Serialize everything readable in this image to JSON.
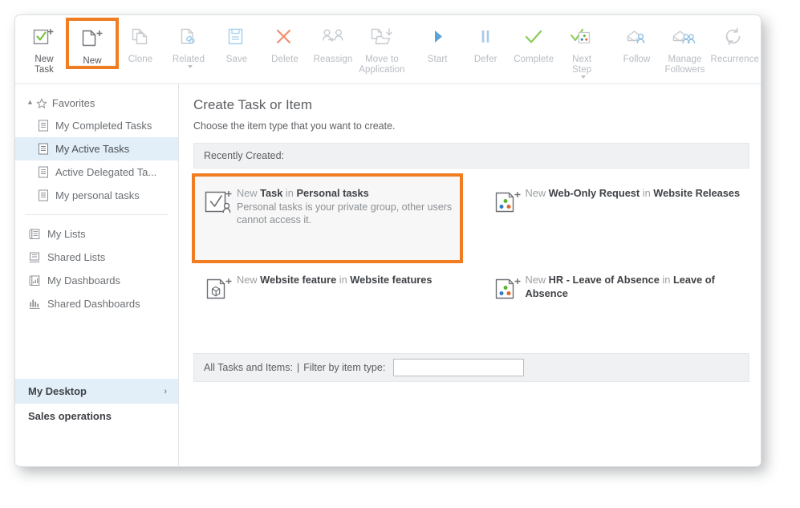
{
  "toolbar": {
    "items": [
      {
        "label": "New\nTask",
        "icon": "new-task-icon",
        "state": "enabled",
        "highlight": false,
        "caret": false
      },
      {
        "label": "New",
        "icon": "new-document-icon",
        "state": "enabled",
        "highlight": true,
        "caret": false
      },
      {
        "label": "Clone",
        "icon": "clone-icon",
        "state": "disabled",
        "highlight": false,
        "caret": false
      },
      {
        "label": "Related",
        "icon": "related-link-icon",
        "state": "disabled",
        "highlight": false,
        "caret": true
      },
      {
        "label": "Save",
        "icon": "save-floppy-icon",
        "state": "disabled",
        "highlight": false,
        "caret": false
      },
      {
        "label": "Delete",
        "icon": "delete-x-icon",
        "state": "disabled",
        "highlight": false,
        "caret": false
      },
      {
        "label": "Reassign",
        "icon": "reassign-users-icon",
        "state": "disabled",
        "highlight": false,
        "caret": false
      },
      {
        "label": "Move to\nApplication",
        "icon": "move-to-application-icon",
        "state": "disabled",
        "highlight": false,
        "caret": false
      },
      {
        "label": "Start",
        "icon": "start-play-icon",
        "state": "disabled",
        "highlight": false,
        "caret": false
      },
      {
        "label": "Defer",
        "icon": "defer-pause-icon",
        "state": "disabled",
        "highlight": false,
        "caret": false
      },
      {
        "label": "Complete",
        "icon": "complete-check-icon",
        "state": "disabled",
        "highlight": false,
        "caret": false
      },
      {
        "label": "Next\nStep",
        "icon": "next-step-icon",
        "state": "disabled",
        "highlight": false,
        "caret": true
      },
      {
        "label": "Follow",
        "icon": "follow-envelope-icon",
        "state": "disabled",
        "highlight": false,
        "caret": false
      },
      {
        "label": "Manage\nFollowers",
        "icon": "manage-followers-icon",
        "state": "disabled",
        "highlight": false,
        "caret": false
      },
      {
        "label": "Recurrence",
        "icon": "recurrence-icon",
        "state": "disabled",
        "highlight": false,
        "caret": false
      }
    ]
  },
  "sidebar": {
    "favorites_label": "Favorites",
    "favorites": [
      {
        "label": "My Completed Tasks",
        "icon": "list-icon",
        "selected": false
      },
      {
        "label": "My Active Tasks",
        "icon": "list-icon",
        "selected": true
      },
      {
        "label": "Active Delegated Ta...",
        "icon": "list-icon",
        "selected": false
      },
      {
        "label": "My personal tasks",
        "icon": "list-icon",
        "selected": false
      }
    ],
    "groups": [
      {
        "label": "My Lists",
        "icon": "my-lists-icon"
      },
      {
        "label": "Shared Lists",
        "icon": "shared-lists-icon"
      },
      {
        "label": "My Dashboards",
        "icon": "my-dashboards-icon"
      },
      {
        "label": "Shared Dashboards",
        "icon": "shared-dashboards-icon"
      }
    ],
    "desktops": [
      {
        "label": "My Desktop",
        "selected": true,
        "chevron": "›"
      },
      {
        "label": "Sales operations",
        "selected": false,
        "chevron": ""
      }
    ]
  },
  "main": {
    "title": "Create Task or Item",
    "subtitle": "Choose the item type that you want to create.",
    "recent_label": "Recently Created:",
    "cards": [
      {
        "prefix": "New ",
        "type": "Task",
        "joiner": " in ",
        "container": "Personal tasks",
        "desc": "Personal tasks is your private group, other users cannot access it.",
        "icon": "new-task-person-icon",
        "highlight": true
      },
      {
        "prefix": "New ",
        "type": "Web-Only Request",
        "joiner": " in ",
        "container": "Website Releases",
        "desc": "",
        "icon": "item-dots-icon",
        "highlight": false
      },
      {
        "prefix": "New ",
        "type": "Website feature",
        "joiner": " in ",
        "container": "Website features",
        "desc": "",
        "icon": "item-cube-icon",
        "highlight": false
      },
      {
        "prefix": "New ",
        "type": "HR - Leave of Absence",
        "joiner": " in ",
        "container": "Leave of Absence",
        "desc": "",
        "icon": "item-dots-icon",
        "highlight": false
      }
    ],
    "filter": {
      "all_label": "All Tasks and Items:",
      "separator": "|",
      "label": "Filter by item type:",
      "value": "",
      "placeholder": ""
    }
  },
  "colors": {
    "accent_highlight": "#f07d22",
    "selection": "#e2eef8",
    "icon_blue": "#6aa9d8",
    "icon_green": "#78c043",
    "icon_orange": "#ef8b4e",
    "dot_green": "#5cb531",
    "dot_blue": "#2f7dc2",
    "dot_orange": "#e2672a",
    "disabled_gray": "#c6cbd0"
  }
}
